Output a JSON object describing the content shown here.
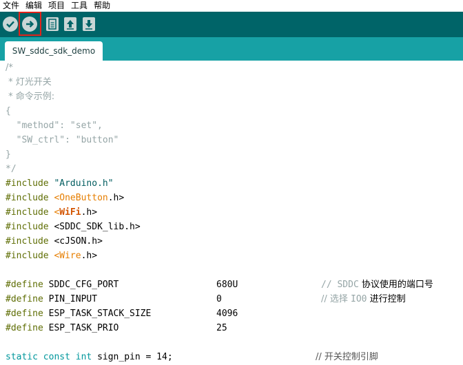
{
  "menu": [
    "文件",
    "编辑",
    "项目",
    "工具",
    "帮助"
  ],
  "toolbar": {
    "verify": "verify-icon",
    "upload": "upload-arrow-icon",
    "new": "new-file-icon",
    "open": "open-icon",
    "save": "save-icon"
  },
  "tab": {
    "label": "SW_sddc_sdk_demo"
  },
  "colors": {
    "toolbar": "#006468",
    "tabbar": "#17a1a5",
    "highlight": "#e2231a"
  },
  "code": {
    "c1": "/*",
    "c2": " * 灯光开关",
    "c3": " * 命令示例:",
    "c4": "{",
    "c5": "  \"method\": \"set\",",
    "c6": "  \"SW_ctrl\": \"button\"",
    "c7": "}",
    "c8": "*/",
    "inc": "#include",
    "inc1": "\"Arduino.h\"",
    "inc2a": "<",
    "inc2b": "OneButton",
    "inc2c": ".h>",
    "inc3a": "<",
    "inc3b": "WiFi",
    "inc3c": ".h>",
    "inc4": "<SDDC_SDK_lib.h>",
    "inc5": "<cJSON.h>",
    "inc6a": "<",
    "inc6b": "Wire",
    "inc6c": ".h>",
    "def": "#define",
    "d1n": "SDDC_CFG_PORT",
    "d1v": "680U",
    "d1c1": "// ",
    "d1c2": "SDDC",
    "d1c3": " 协议使用的端口号",
    "d2n": "PIN_INPUT",
    "d2v": "0",
    "d2c1": "// 选择 ",
    "d2c2": "IO0",
    "d2c3": " 进行控制",
    "d3n": "ESP_TASK_STACK_SIZE",
    "d3v": "4096",
    "d4n": "ESP_TASK_PRIO",
    "d4v": "25",
    "s1": "static",
    "s2": "const",
    "s3": "int",
    "s4": "sign_pin = 14;",
    "s5": "// 开关控制引脚"
  }
}
